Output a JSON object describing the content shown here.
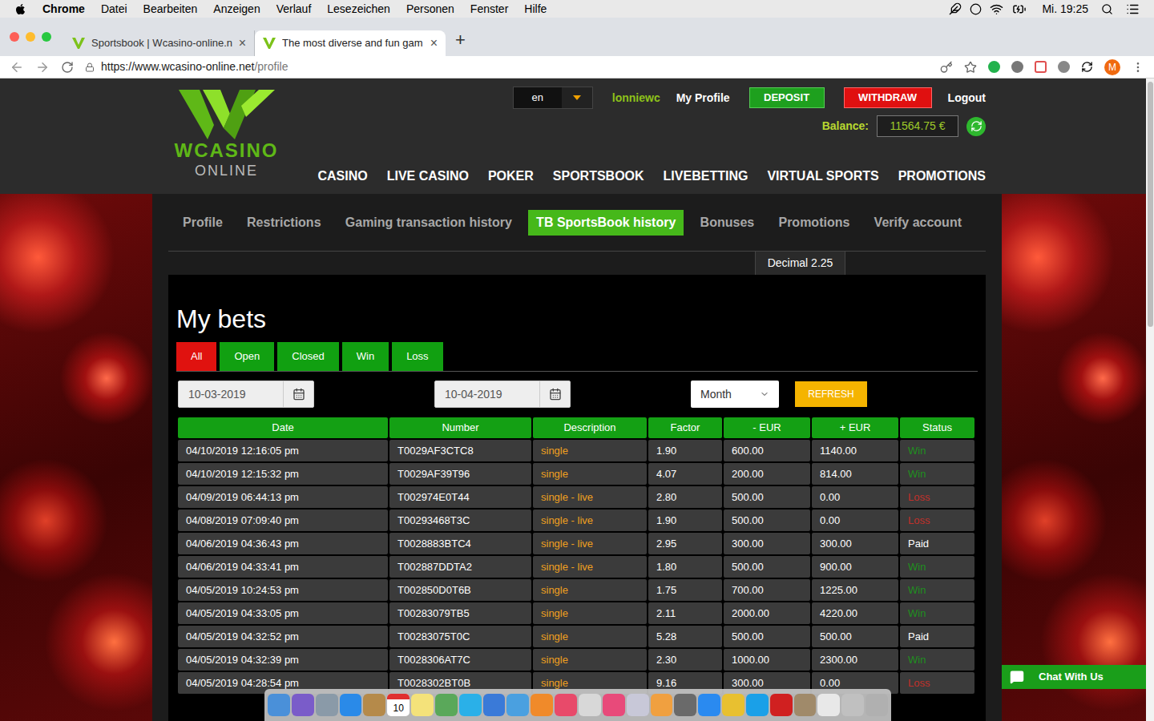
{
  "menubar": {
    "app": "Chrome",
    "items": [
      "Datei",
      "Bearbeiten",
      "Anzeigen",
      "Verlauf",
      "Lesezeichen",
      "Personen",
      "Fenster",
      "Hilfe"
    ],
    "clock": "Mi. 19:25"
  },
  "browser": {
    "tabs": [
      {
        "label": "Sportsbook | Wcasino-online.n",
        "selected": false
      },
      {
        "label": "The most diverse and fun gam",
        "selected": true
      }
    ],
    "close": "×",
    "new_tab": "+",
    "url_host": "https://www.wcasino-online.net",
    "url_path": "/profile",
    "profile_initial": "M"
  },
  "header": {
    "logo_top": "WCASINO",
    "logo_bottom": "ONLINE",
    "language": "en",
    "username": "lonniewc",
    "my_profile": "My Profile",
    "deposit": "DEPOSIT",
    "withdraw": "WITHDRAW",
    "logout": "Logout",
    "balance_label": "Balance:",
    "balance": "11564.75 €",
    "nav": [
      "CASINO",
      "LIVE CASINO",
      "POKER",
      "SPORTSBOOK",
      "LIVEBETTING",
      "VIRTUAL SPORTS",
      "PROMOTIONS"
    ]
  },
  "profile_tabs": [
    {
      "label": "Profile",
      "selected": false
    },
    {
      "label": "Restrictions",
      "selected": false
    },
    {
      "label": "Gaming transaction history",
      "selected": false
    },
    {
      "label": "TB SportsBook history",
      "selected": true
    },
    {
      "label": "Bonuses",
      "selected": false
    },
    {
      "label": "Promotions",
      "selected": false
    },
    {
      "label": "Verify account",
      "selected": false
    }
  ],
  "odds_format": "Decimal 2.25",
  "heading": "My bets",
  "filters": [
    {
      "label": "All",
      "selected": true
    },
    {
      "label": "Open",
      "selected": false
    },
    {
      "label": "Closed",
      "selected": false
    },
    {
      "label": "Win",
      "selected": false
    },
    {
      "label": "Loss",
      "selected": false
    }
  ],
  "date_from": "10-03-2019",
  "date_to": "10-04-2019",
  "period": "Month",
  "refresh": "REFRESH",
  "table": {
    "columns": [
      "Date",
      "Number",
      "Description",
      "Factor",
      "- EUR",
      "+ EUR",
      "Status"
    ],
    "rows": [
      {
        "date": "04/10/2019 12:16:05 pm",
        "number": "T0029AF3CTC8",
        "description": "single",
        "factor": "1.90",
        "stake": "600.00",
        "payout": "1140.00",
        "status": "Win",
        "color": "#1f8f1f"
      },
      {
        "date": "04/10/2019 12:15:32 pm",
        "number": "T0029AF39T96",
        "description": "single",
        "factor": "4.07",
        "stake": "200.00",
        "payout": "814.00",
        "status": "Win",
        "color": "#1f8f1f"
      },
      {
        "date": "04/09/2019 06:44:13 pm",
        "number": "T002974E0T44",
        "description": "single - live",
        "factor": "2.80",
        "stake": "500.00",
        "payout": "0.00",
        "status": "Loss",
        "color": "#c0302a"
      },
      {
        "date": "04/08/2019 07:09:40 pm",
        "number": "T00293468T3C",
        "description": "single - live",
        "factor": "1.90",
        "stake": "500.00",
        "payout": "0.00",
        "status": "Loss",
        "color": "#c0302a"
      },
      {
        "date": "04/06/2019 04:36:43 pm",
        "number": "T0028883BTC4",
        "description": "single - live",
        "factor": "2.95",
        "stake": "300.00",
        "payout": "300.00",
        "status": "Paid",
        "color": "#ffffff"
      },
      {
        "date": "04/06/2019 04:33:41 pm",
        "number": "T002887DDTA2",
        "description": "single - live",
        "factor": "1.80",
        "stake": "500.00",
        "payout": "900.00",
        "status": "Win",
        "color": "#1f8f1f"
      },
      {
        "date": "04/05/2019 10:24:53 pm",
        "number": "T002850D0T6B",
        "description": "single",
        "factor": "1.75",
        "stake": "700.00",
        "payout": "1225.00",
        "status": "Win",
        "color": "#1f8f1f"
      },
      {
        "date": "04/05/2019 04:33:05 pm",
        "number": "T00283079TB5",
        "description": "single",
        "factor": "2.11",
        "stake": "2000.00",
        "payout": "4220.00",
        "status": "Win",
        "color": "#1f8f1f"
      },
      {
        "date": "04/05/2019 04:32:52 pm",
        "number": "T00283075T0C",
        "description": "single",
        "factor": "5.28",
        "stake": "500.00",
        "payout": "500.00",
        "status": "Paid",
        "color": "#ffffff"
      },
      {
        "date": "04/05/2019 04:32:39 pm",
        "number": "T0028306AT7C",
        "description": "single",
        "factor": "2.30",
        "stake": "1000.00",
        "payout": "2300.00",
        "status": "Win",
        "color": "#1f8f1f"
      },
      {
        "date": "04/05/2019 04:28:54 pm",
        "number": "T0028302BT0B",
        "description": "single",
        "factor": "9.16",
        "stake": "300.00",
        "payout": "0.00",
        "status": "Loss",
        "color": "#c0302a"
      }
    ]
  },
  "chat": "Chat With Us",
  "dock": {
    "calendar_day": "10"
  }
}
